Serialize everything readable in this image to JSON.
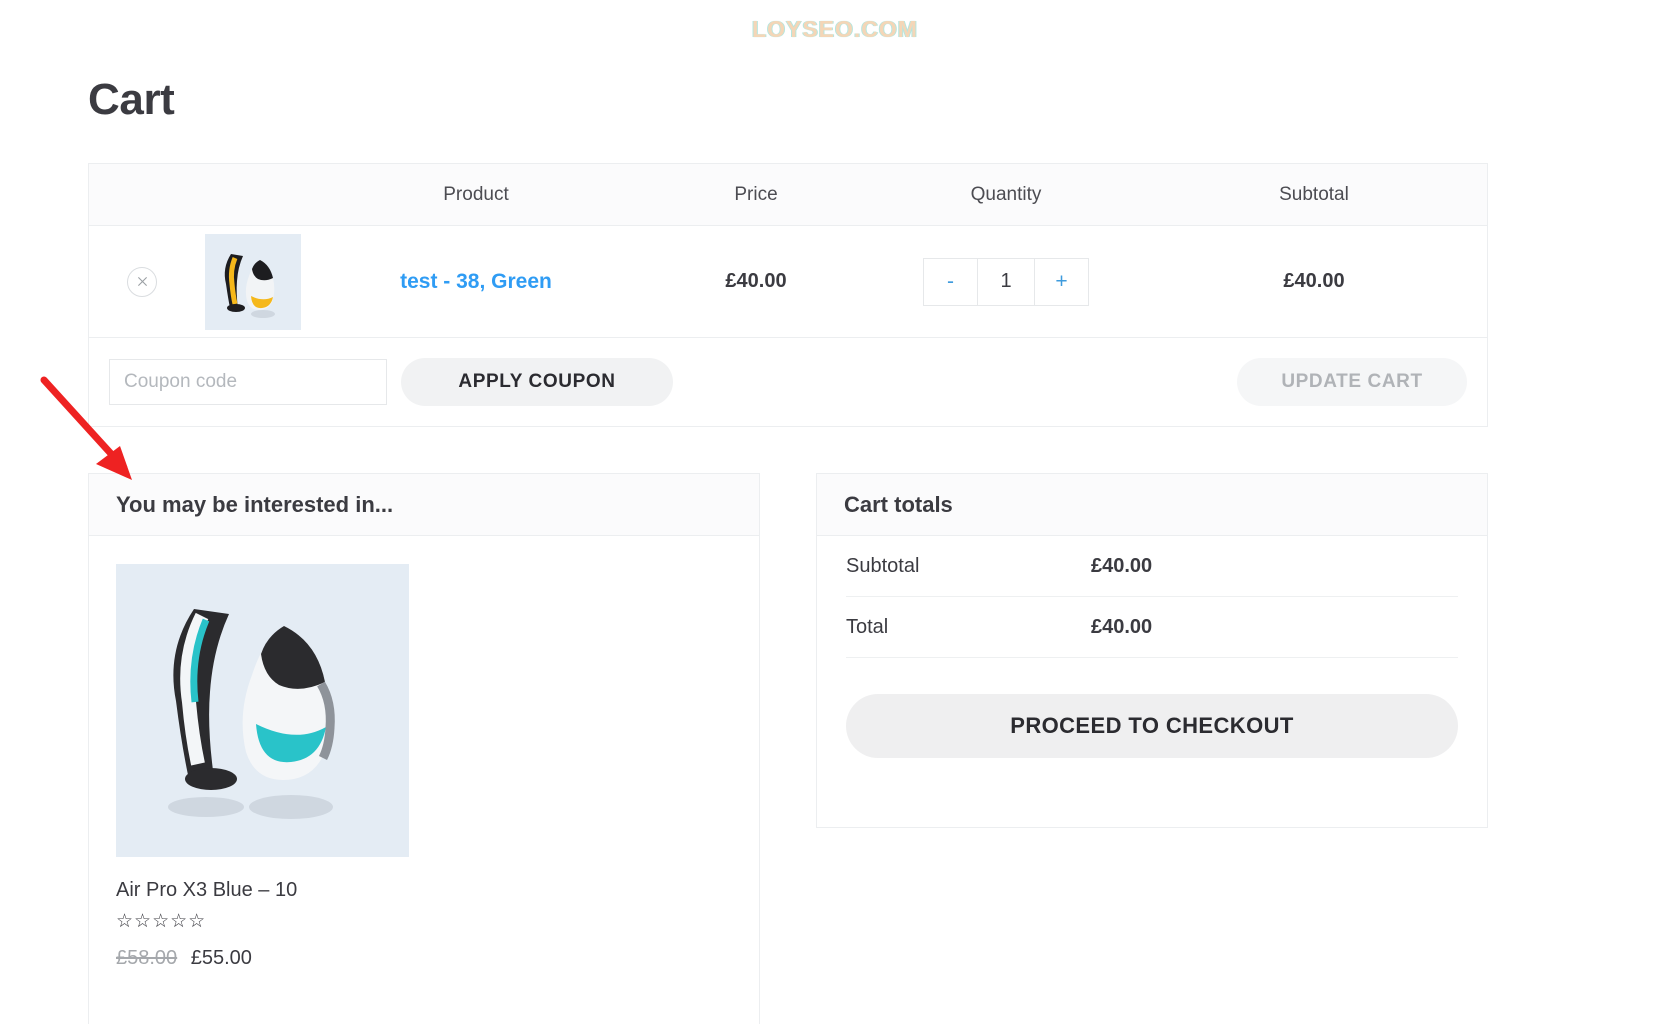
{
  "watermark": {
    "text": "LOYSEO.COM"
  },
  "page": {
    "title": "Cart"
  },
  "cart_table": {
    "headers": {
      "remove": "",
      "thumbnail": "",
      "product": "Product",
      "price": "Price",
      "quantity": "Quantity",
      "subtotal": "Subtotal"
    },
    "rows": [
      {
        "remove_icon": "close-icon",
        "thumbnail_alt": "yellow-black-sneakers",
        "name": "test - 38, Green",
        "price": "£40.00",
        "qty_minus": "-",
        "qty_value": "1",
        "qty_plus": "+",
        "subtotal": "£40.00"
      }
    ]
  },
  "coupon": {
    "placeholder": "Coupon code",
    "value": "",
    "apply_label": "APPLY COUPON",
    "update_label": "UPDATE CART"
  },
  "upsell": {
    "heading": "You may be interested in...",
    "products": [
      {
        "thumbnail_alt": "blue-teal-sneakers",
        "name": "Air Pro X3 Blue – 10",
        "rating_stars": "☆☆☆☆☆",
        "old_price": "£58.00",
        "price": "£55.00"
      }
    ]
  },
  "totals": {
    "heading": "Cart totals",
    "rows": [
      {
        "label": "Subtotal",
        "value": "£40.00"
      },
      {
        "label": "Total",
        "value": "£40.00"
      }
    ],
    "checkout_label": "PROCEED TO CHECKOUT"
  },
  "colors": {
    "link": "#2f9cf4",
    "heading": "#3b3b41",
    "border": "#eceef0",
    "button_bg": "#f1f2f3",
    "disabled_text": "#b0b3b7",
    "annotation": "#ee2222",
    "thumb_bg": "#e4ecf4"
  }
}
